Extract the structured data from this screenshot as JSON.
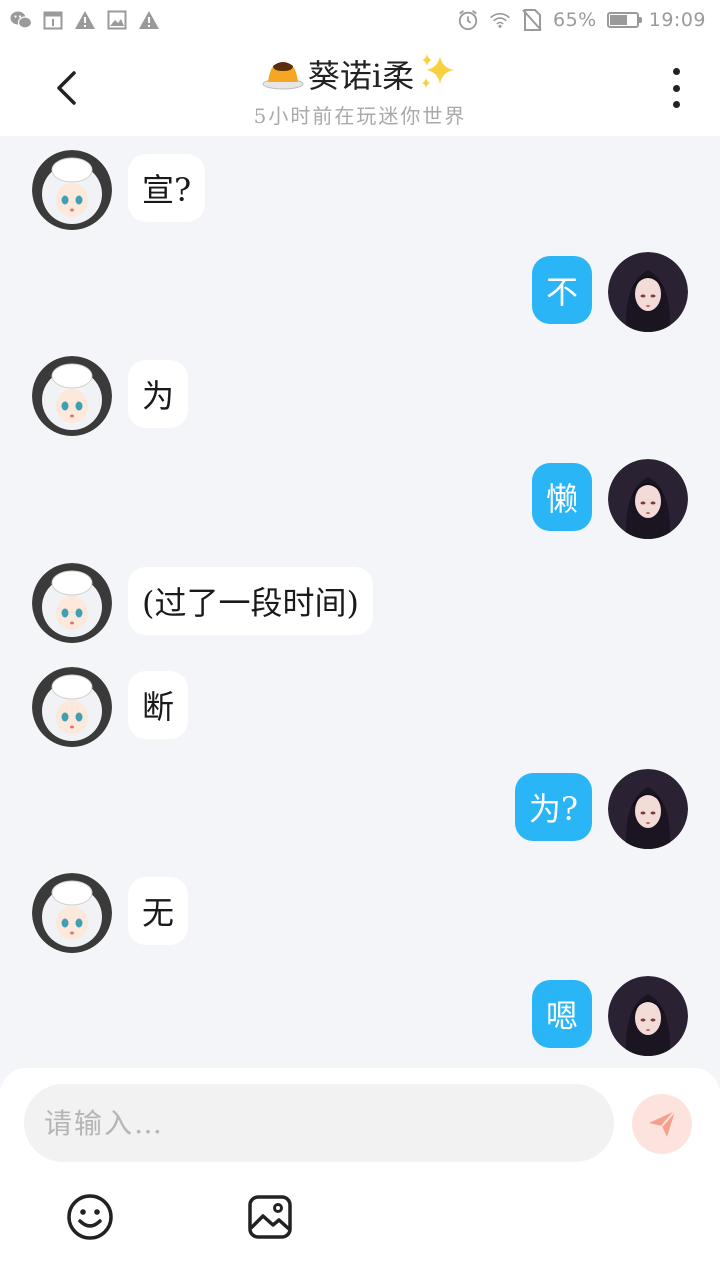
{
  "status_bar": {
    "battery": "65%",
    "time": "19:09",
    "battery_level": 0.65
  },
  "header": {
    "contact_name": "葵诺i柔",
    "presence": "5小时前在玩迷你世界",
    "name_decoration_left": "pudding-emoji",
    "name_decoration_right": "sparkles-emoji"
  },
  "messages": [
    {
      "side": "left",
      "text": "宣?"
    },
    {
      "side": "right",
      "text": "不"
    },
    {
      "side": "left",
      "text": "为"
    },
    {
      "side": "right",
      "text": "懒"
    },
    {
      "side": "left",
      "text": "(过了一段时间)"
    },
    {
      "side": "left",
      "text": "断"
    },
    {
      "side": "right",
      "text": "为?"
    },
    {
      "side": "left",
      "text": "无"
    },
    {
      "side": "right",
      "text": "嗯"
    }
  ],
  "composer": {
    "placeholder": "请输入…",
    "value": ""
  },
  "colors": {
    "accent_blue": "#29b5f6",
    "send_button": "#fde3dd",
    "send_icon": "#f4a08d",
    "background": "#f3f5f8"
  }
}
